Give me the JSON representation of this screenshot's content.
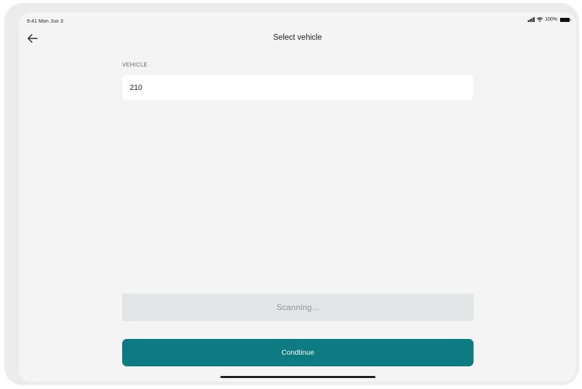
{
  "status_bar": {
    "time": "9:41 Mon Jun 3",
    "battery_percent": "100%",
    "icons": [
      "signal-icon",
      "wifi-icon",
      "battery-icon"
    ]
  },
  "header": {
    "back_icon": "arrow-left-icon",
    "title": "Select vehicle"
  },
  "form": {
    "vehicle_label": "VEHICLE",
    "vehicle_value": "210"
  },
  "scanning": {
    "text": "Scanning..."
  },
  "footer": {
    "continue_label": "Condtinue"
  },
  "colors": {
    "accent": "#0e7a82",
    "background": "#f4f4f4",
    "scanning_bg": "#e2e6e6"
  }
}
